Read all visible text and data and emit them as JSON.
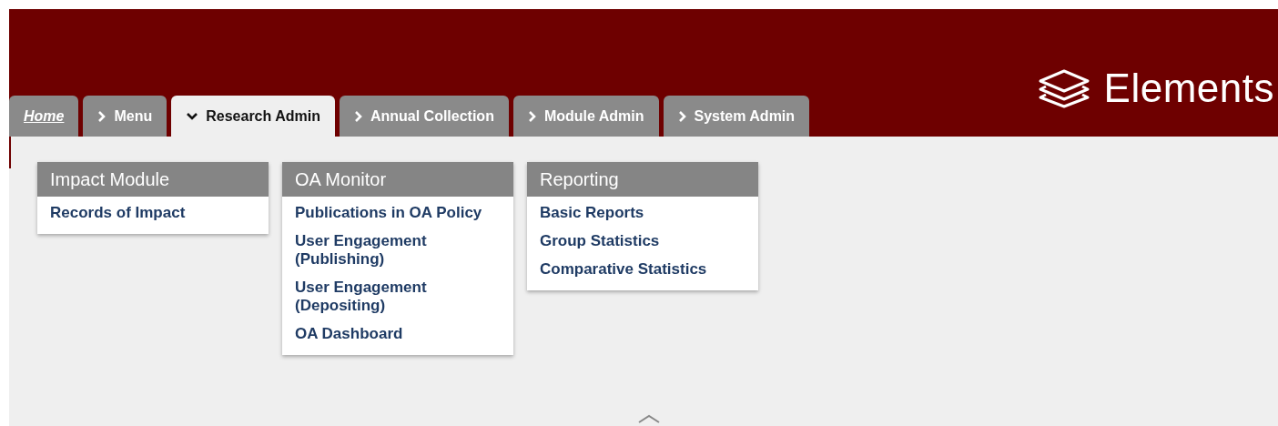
{
  "brand": {
    "name": "Elements"
  },
  "tabs": [
    {
      "label": "Home",
      "kind": "link",
      "selected": false
    },
    {
      "label": "Menu",
      "kind": "menu",
      "selected": false
    },
    {
      "label": "Research Admin",
      "kind": "menu",
      "selected": true
    },
    {
      "label": "Annual Collection",
      "kind": "menu",
      "selected": false
    },
    {
      "label": "Module Admin",
      "kind": "menu",
      "selected": false
    },
    {
      "label": "System Admin",
      "kind": "menu",
      "selected": false
    }
  ],
  "menu_groups": [
    {
      "title": "Impact Module",
      "items": [
        "Records of Impact"
      ]
    },
    {
      "title": "OA Monitor",
      "items": [
        "Publications in OA Policy",
        "User Engagement (Publishing)",
        "User Engagement (Depositing)",
        "OA Dashboard"
      ]
    },
    {
      "title": "Reporting",
      "items": [
        "Basic Reports",
        "Group Statistics",
        "Comparative Statistics"
      ]
    }
  ]
}
